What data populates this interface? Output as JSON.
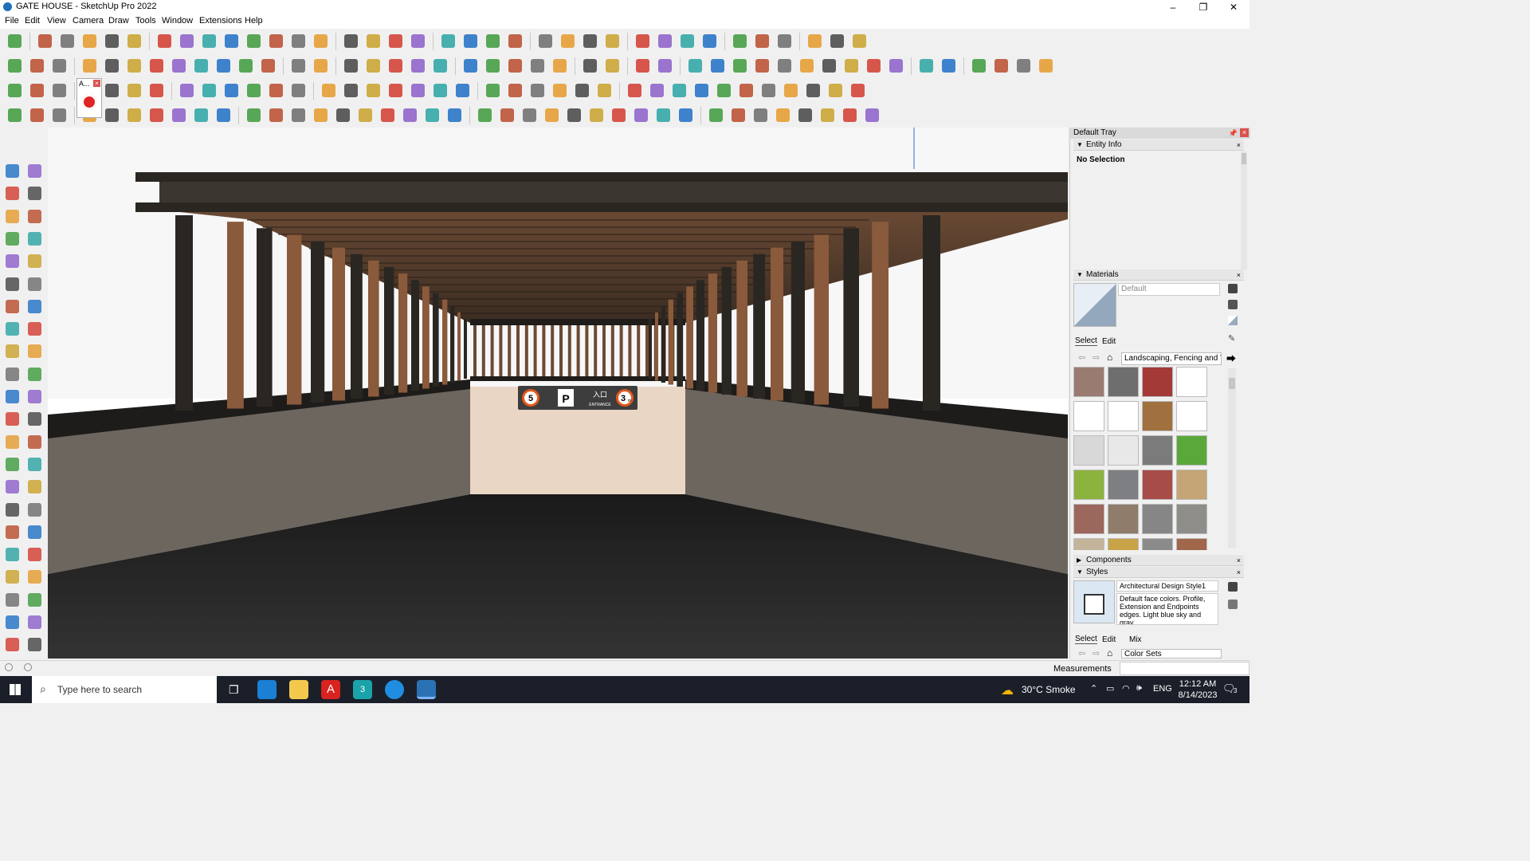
{
  "window": {
    "title": "GATE HOUSE - SketchUp Pro 2022",
    "minimize_glyph": "–",
    "maximize_glyph": "❐",
    "close_glyph": "✕"
  },
  "menu": [
    "File",
    "Edit",
    "View",
    "Camera",
    "Draw",
    "Tools",
    "Window",
    "Extensions",
    "Help"
  ],
  "floating_tool_label": "A...",
  "tray": {
    "title": "Default Tray",
    "entity_info": {
      "title": "Entity Info",
      "selection": "No Selection"
    },
    "materials": {
      "title": "Materials",
      "current": "Default",
      "tabs": [
        "Select",
        "Edit"
      ],
      "collection": "Landscaping, Fencing and V",
      "swatch_colors": [
        "#9a7b72",
        "#6e6e6e",
        "#a33a38",
        "#ffffff",
        "#ffffff",
        "#ffffff",
        "#a0703e",
        "#ffffff",
        "#d8d8d8",
        "#e8e8e8",
        "#7b7b7b",
        "#5aa83a",
        "#8db33f",
        "#7d7f82",
        "#a84c47",
        "#c5a576",
        "#9c675c",
        "#8f7c6a",
        "#868686",
        "#8f8d8a",
        "#c4b49a",
        "#c8a348",
        "#8b8b8b",
        "#a1674a"
      ]
    },
    "components": {
      "title": "Components"
    },
    "styles": {
      "title": "Styles",
      "name": "Architectural Design Style1",
      "description": "Default face colors. Profile, Extension and Endpoints edges. Light blue sky and gray",
      "tabs": [
        "Select",
        "Edit",
        "Mix"
      ],
      "collection": "Color Sets"
    }
  },
  "statusbar": {
    "measurements_label": "Measurements"
  },
  "scene": {
    "sign_numbers": [
      "5",
      "P",
      "3"
    ],
    "sign_text_top": "入口",
    "sign_text_bottom": "ENTRANCE",
    "sign_small": "m"
  },
  "taskbar": {
    "search_placeholder": "Type here to search",
    "weather": "30°C  Smoke",
    "language": "ENG",
    "time": "12:12 AM",
    "date": "8/14/2023",
    "notification_count": "3"
  },
  "colors": {
    "beam_dark": "#2a2622",
    "wood": "#8a5a3c",
    "wall": "#6f6a63",
    "floor": "#2c2c2c",
    "back_wall": "#e9d6c5",
    "accent_blue": "#1d6fb8"
  }
}
